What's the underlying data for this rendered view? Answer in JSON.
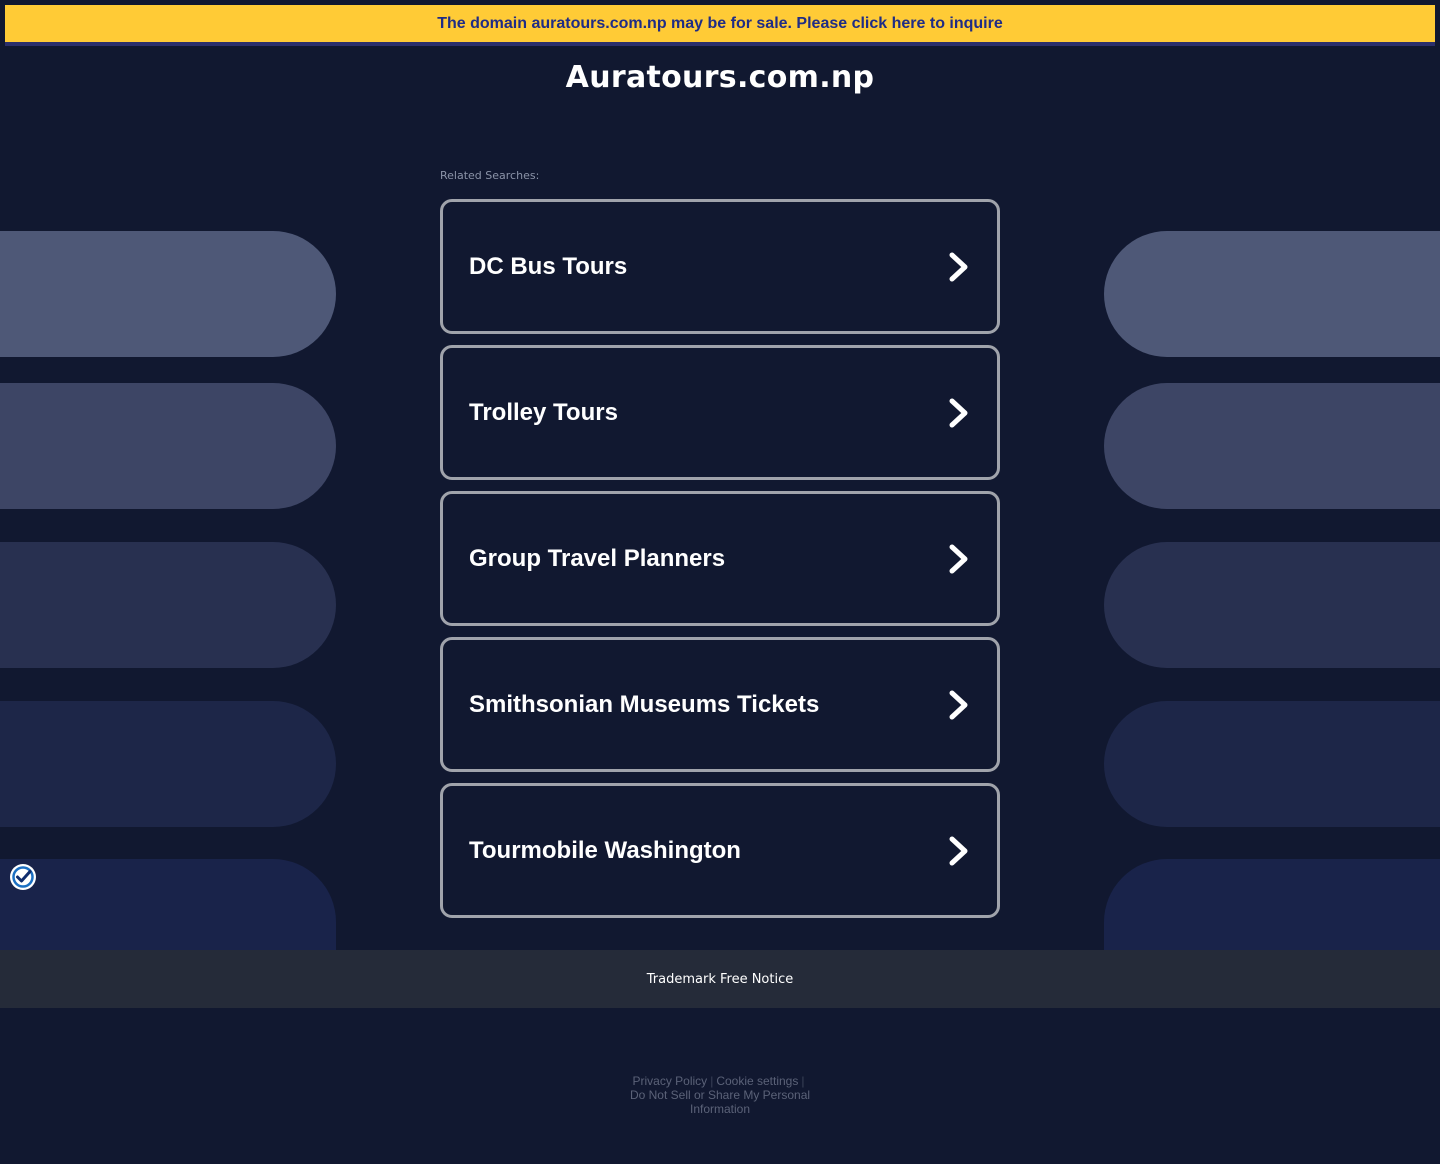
{
  "banner": {
    "text": "The domain auratours.com.np may be for sale. Please click here to inquire"
  },
  "header": {
    "title": "Auratours.com.np"
  },
  "related": {
    "label": "Related Searches:",
    "items": [
      {
        "label": "DC Bus Tours"
      },
      {
        "label": "Trolley Tours"
      },
      {
        "label": "Group Travel Planners"
      },
      {
        "label": "Smithsonian Museums Tickets"
      },
      {
        "label": "Tourmobile Washington"
      }
    ]
  },
  "footer": {
    "trademark": "Trademark Free Notice",
    "privacy_policy": "Privacy Policy",
    "cookie_settings": "Cookie settings",
    "do_not_sell": "Do Not Sell or Share My Personal Information",
    "separator": "|"
  },
  "icons": {
    "chevron": "chevron-right-icon",
    "privacy": "privacy-check-icon"
  },
  "colors": {
    "background": "#111830",
    "banner": "#ffcb36",
    "banner_text": "#1f2c86",
    "card_border": "#a0a3ab",
    "footer_bar": "#252b39"
  }
}
